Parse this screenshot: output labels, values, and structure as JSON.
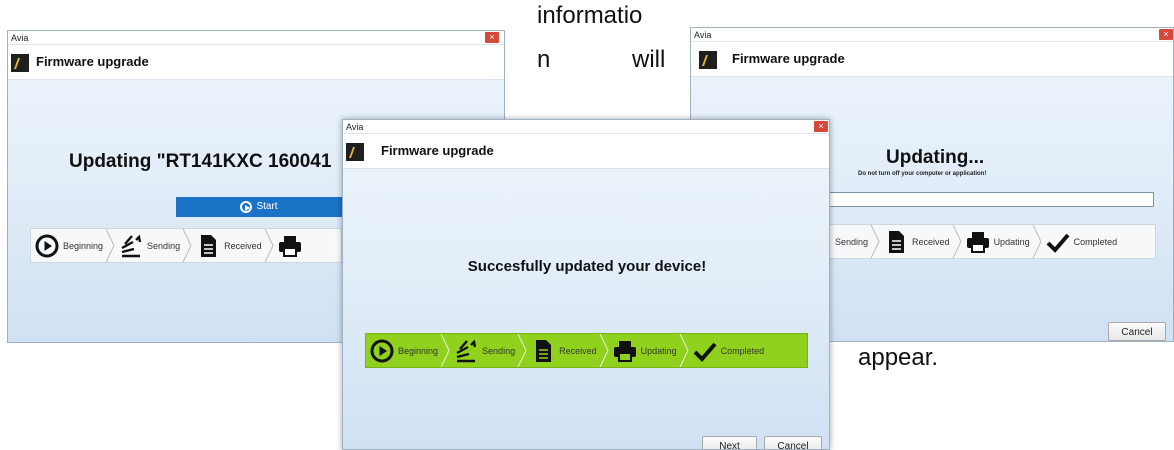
{
  "doc": {
    "word1": "informatio",
    "word2": "n",
    "word3": "will",
    "word4": "appear."
  },
  "window_left": {
    "window_title": "Avia",
    "close_glyph": "×",
    "header_title": "Firmware upgrade",
    "message": "Updating \"RT141KXC 160041",
    "start_label": "Start",
    "steps": [
      "Beginning",
      "Sending",
      "Received"
    ]
  },
  "window_right": {
    "window_title": "Avia",
    "close_glyph": "×",
    "header_title": "Firmware upgrade",
    "message": "Updating...",
    "submessage": "Do not turn off your computer or application!",
    "progress": 0,
    "steps": [
      "Sending",
      "Received",
      "Updating",
      "Completed"
    ],
    "cancel_label": "Cancel"
  },
  "window_center": {
    "window_title": "Avia",
    "close_glyph": "×",
    "header_title": "Firmware upgrade",
    "message": "Succesfully updated your device!",
    "steps": [
      "Beginning",
      "Sending",
      "Received",
      "Updating",
      "Completed"
    ],
    "next_label": "Next",
    "cancel_label": "Cancel"
  },
  "colors": {
    "start_button": "#1a73c7",
    "steps_active": "#8fd11c",
    "close_button": "#d6483a"
  }
}
